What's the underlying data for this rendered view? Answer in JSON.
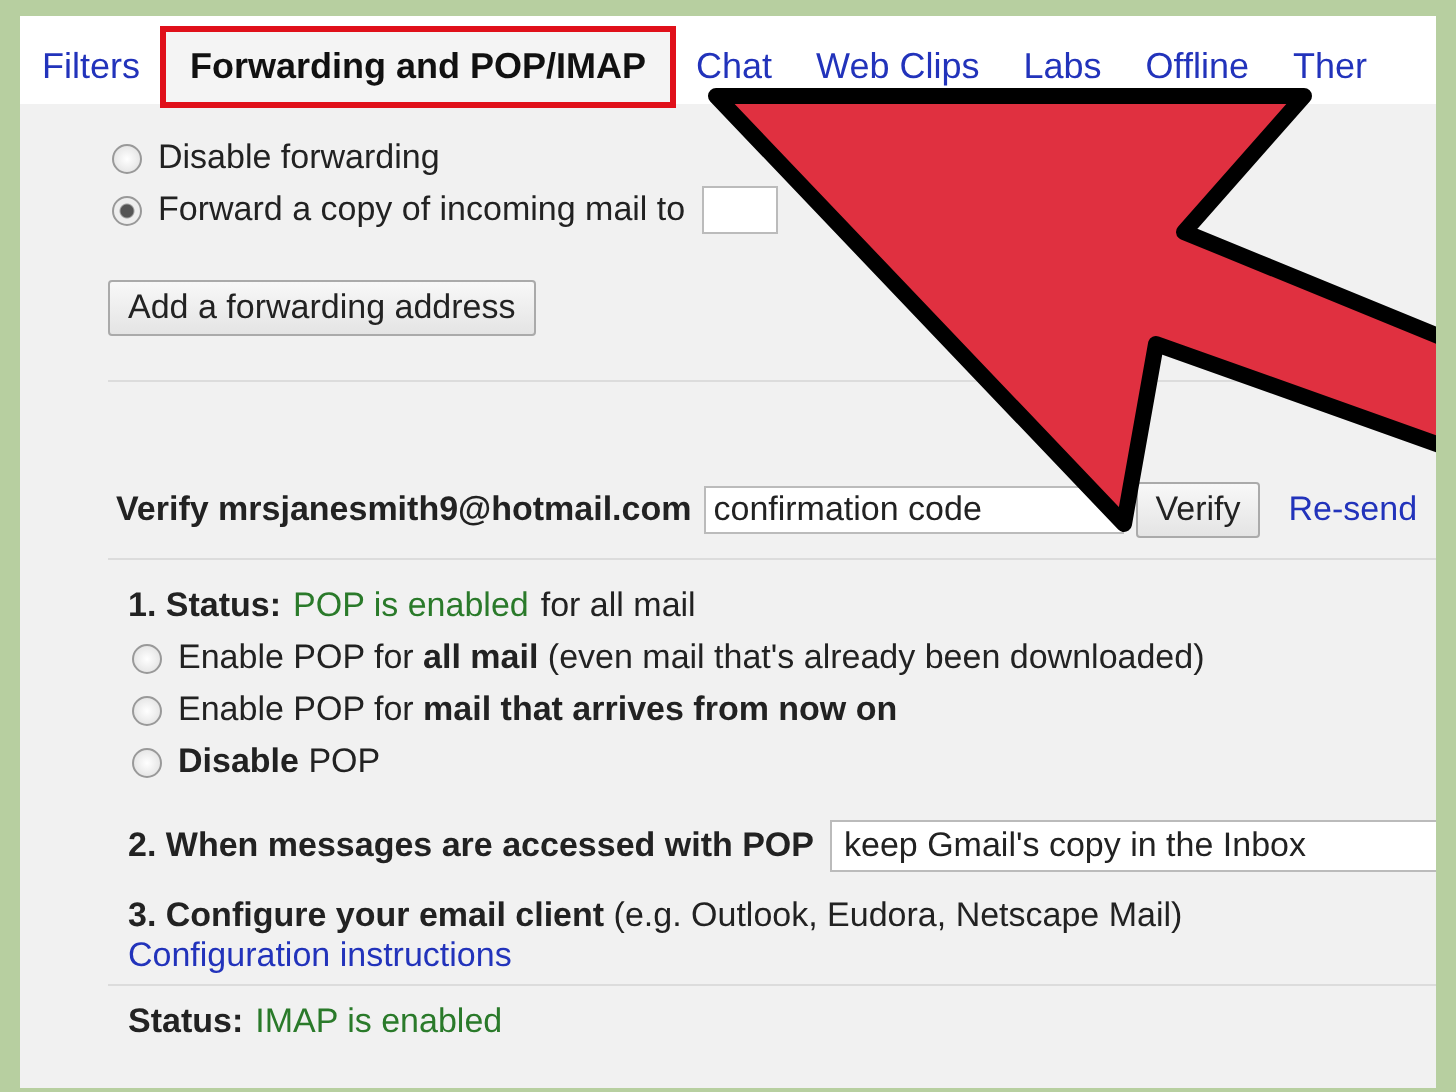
{
  "tabs": [
    {
      "label": "Filters",
      "selected": false
    },
    {
      "label": "Forwarding and POP/IMAP",
      "selected": true
    },
    {
      "label": "Chat",
      "selected": false
    },
    {
      "label": "Web Clips",
      "selected": false
    },
    {
      "label": "Labs",
      "selected": false
    },
    {
      "label": "Offline",
      "selected": false
    },
    {
      "label": "Ther",
      "selected": false
    }
  ],
  "forwarding": {
    "options": [
      {
        "label": "Disable forwarding",
        "selected": false
      },
      {
        "label": "Forward a copy of incoming mail to",
        "selected": true
      }
    ],
    "add_button": "Add a forwarding address"
  },
  "verify": {
    "label": "Verify mrsjanesmith9@hotmail.com",
    "code_placeholder": "confirmation code",
    "button": "Verify",
    "resend_link": "Re-send"
  },
  "pop": {
    "status_label": "1. Status:",
    "status_value": "POP is enabled",
    "status_suffix": "for all mail",
    "options": [
      {
        "label": "Enable POP for **all mail** (even mail that's already been downloaded)",
        "selected": false
      },
      {
        "label": "Enable POP for **mail that arrives from now on**",
        "selected": false
      },
      {
        "label": "**Disable** POP",
        "selected": false
      }
    ],
    "access_label": "2. When messages are accessed with POP",
    "access_value": "keep Gmail's copy in the Inbox",
    "configure_label": "**3. Configure your email client** (e.g. Outlook, Eudora, Netscape Mail)",
    "configure_link": "Configuration instructions"
  },
  "imap": {
    "status_label": "Status:",
    "status_value": "IMAP is enabled"
  }
}
